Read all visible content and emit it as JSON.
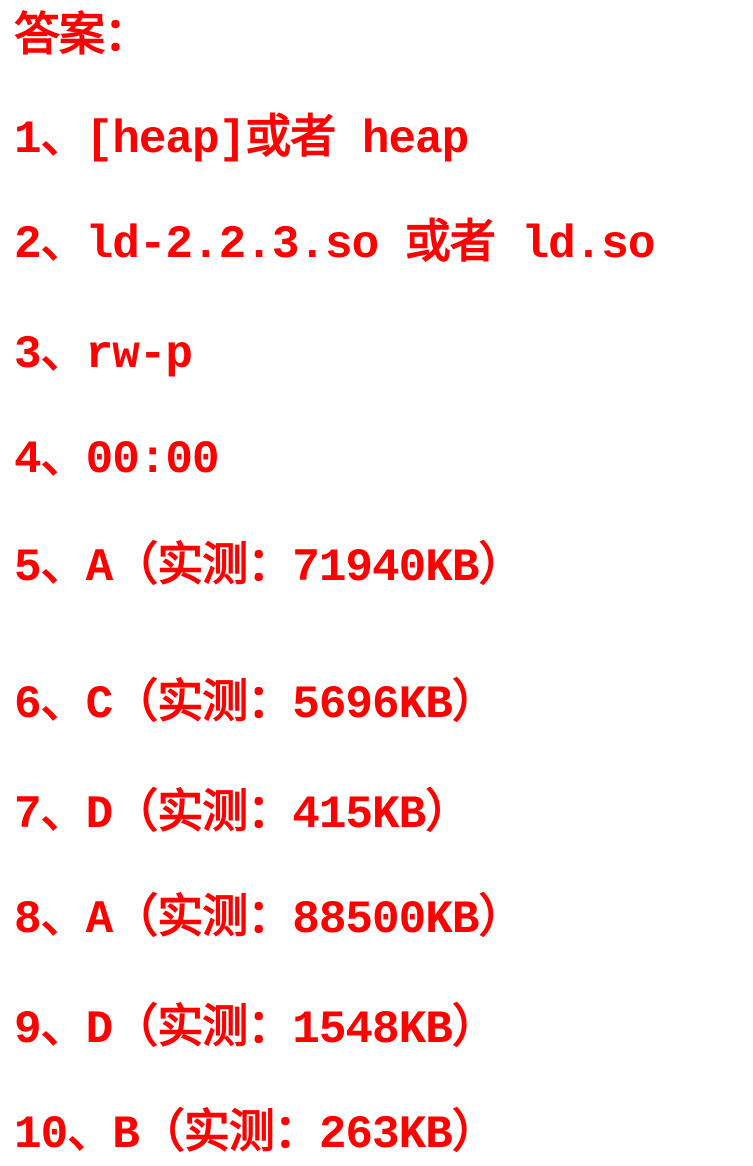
{
  "title": "答案：",
  "answers": [
    "1、[heap]或者 heap",
    "2、ld-2.2.3.so 或者 ld.so",
    "3、rw-p",
    "4、00:00",
    "5、A（实测：71940KB）",
    "6、C（实测：5696KB）",
    "7、D（实测：415KB）",
    "8、A（实测：88500KB）",
    "9、D（实测：1548KB）",
    "10、B（实测：263KB）"
  ],
  "text_color": "#ff0000"
}
